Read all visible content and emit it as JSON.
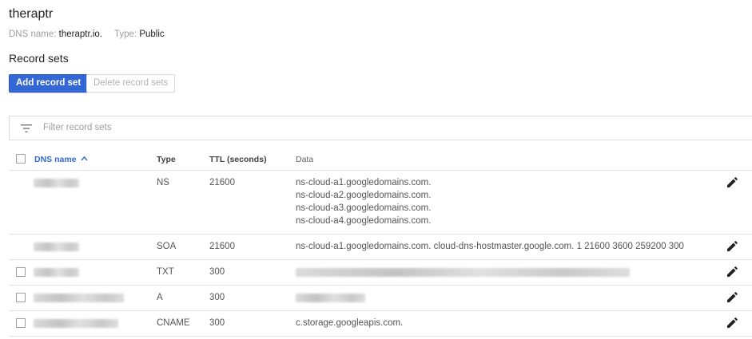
{
  "zone": {
    "title": "theraptr",
    "dns_name_label": "DNS name:",
    "dns_name_value": "theraptr.io.",
    "type_label": "Type:",
    "type_value": "Public"
  },
  "record_sets": {
    "title": "Record sets",
    "add_button": "Add record set",
    "delete_button": "Delete record sets"
  },
  "filter": {
    "placeholder": "Filter record sets",
    "icon": "filter-list-icon"
  },
  "table": {
    "columns": [
      "DNS name",
      "Type",
      "TTL (seconds)",
      "Data"
    ],
    "sort": {
      "column": "DNS name",
      "direction": "ascending",
      "icon": "arrow-up-icon"
    },
    "rows": [
      {
        "type": "NS",
        "ttl": "21600",
        "data": [
          "ns-cloud-a1.googledomains.com.",
          "ns-cloud-a2.googledomains.com.",
          "ns-cloud-a3.googledomains.com.",
          "ns-cloud-a4.googledomains.com."
        ],
        "has_checkbox": false
      },
      {
        "type": "SOA",
        "ttl": "21600",
        "data": [
          "ns-cloud-a1.googledomains.com. cloud-dns-hostmaster.google.com. 1 21600 3600 259200 300"
        ],
        "has_checkbox": false
      },
      {
        "type": "TXT",
        "ttl": "300",
        "data": [],
        "has_checkbox": true
      },
      {
        "type": "A",
        "ttl": "300",
        "data": [],
        "has_checkbox": true
      },
      {
        "type": "CNAME",
        "ttl": "300",
        "data": [
          "c.storage.googleapis.com."
        ],
        "has_checkbox": true
      }
    ],
    "row_action_icon": "edit-pencil-icon"
  },
  "colors": {
    "primary": "#3367d6",
    "text": "#212121",
    "muted": "#9e9e9e",
    "divider": "#e0e0e0"
  }
}
